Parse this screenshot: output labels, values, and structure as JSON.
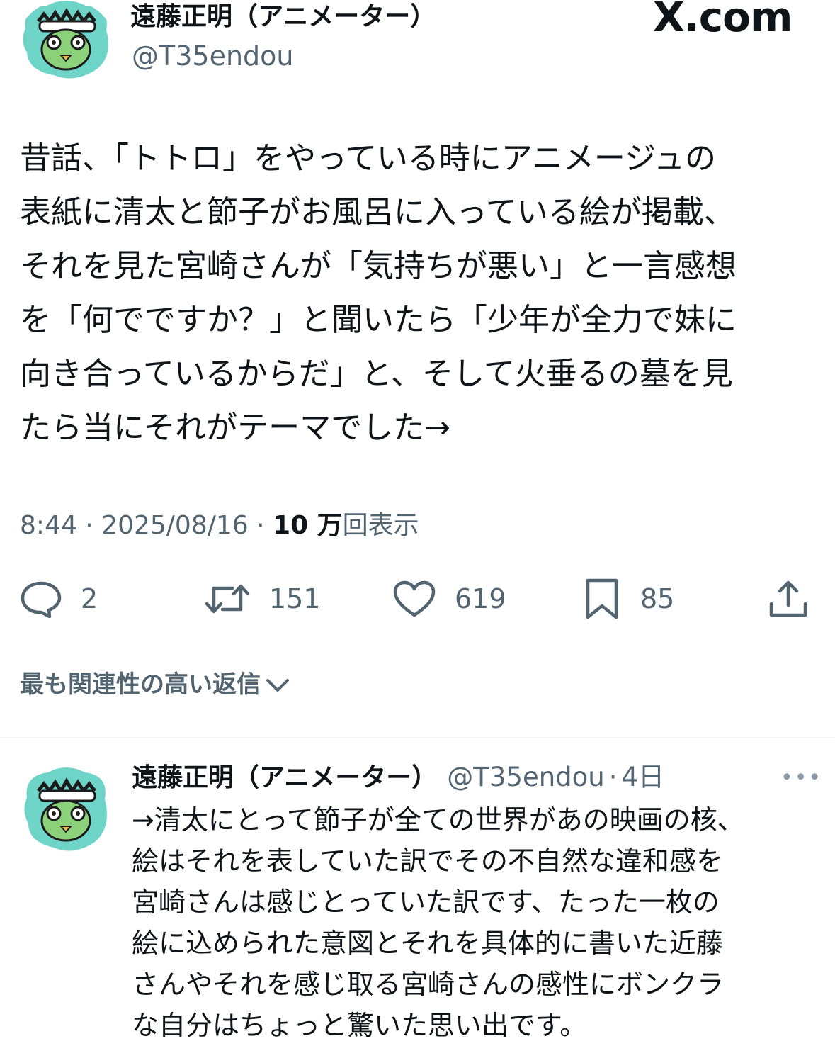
{
  "site_logo": "X.com",
  "tweet": {
    "author_name": "遠藤正明（アニメーター）",
    "author_handle": "@T35endou",
    "lines": [
      "昔話、「トトロ」をやっている時にアニメージュの",
      "表紙に清太と節子がお風呂に入っている絵が掲載、",
      "それを見た宮崎さんが「気持ちが悪い」と一言感想",
      "を「何でですか？」と聞いたら「少年が全力で妹に",
      "向き合っているからだ」と、そして火垂るの墓を見",
      "たら当にそれがテーマでした→"
    ],
    "time": "8:44",
    "date": "2025/08/16",
    "views_count": "10 万",
    "views_label": "回表示"
  },
  "actions": {
    "reply_count": "2",
    "retweet_count": "151",
    "like_count": "619",
    "bookmark_count": "85"
  },
  "reply_sort": {
    "label": "最も関連性の高い返信"
  },
  "reply": {
    "author_name": "遠藤正明（アニメーター）",
    "author_handle": "@T35endou",
    "time_ago": "4日",
    "lines": [
      "→清太にとって節子が全ての世界があの映画の核、",
      "絵はそれを表していた訳でその不自然な違和感を",
      "宮崎さんは感じとっていた訳です、たった一枚の",
      "絵に込められた意図とそれを具体的に書いた近藤",
      "さんやそれを感じ取る宮崎さんの感性にボンクラ",
      "な自分はちょっと驚いた思い出です。"
    ]
  },
  "icons": {
    "avatar": "kappa-avatar-icon",
    "reply": "comment-bubble-icon",
    "retweet": "retweet-icon",
    "like": "heart-icon",
    "bookmark": "bookmark-icon",
    "share": "share-icon",
    "sort_chevron": "chevron-down-icon",
    "more": "more-dots-icon"
  },
  "colors": {
    "text": "#0f1419",
    "secondary": "#536471",
    "avatar_bg": "#6fd4c8"
  }
}
